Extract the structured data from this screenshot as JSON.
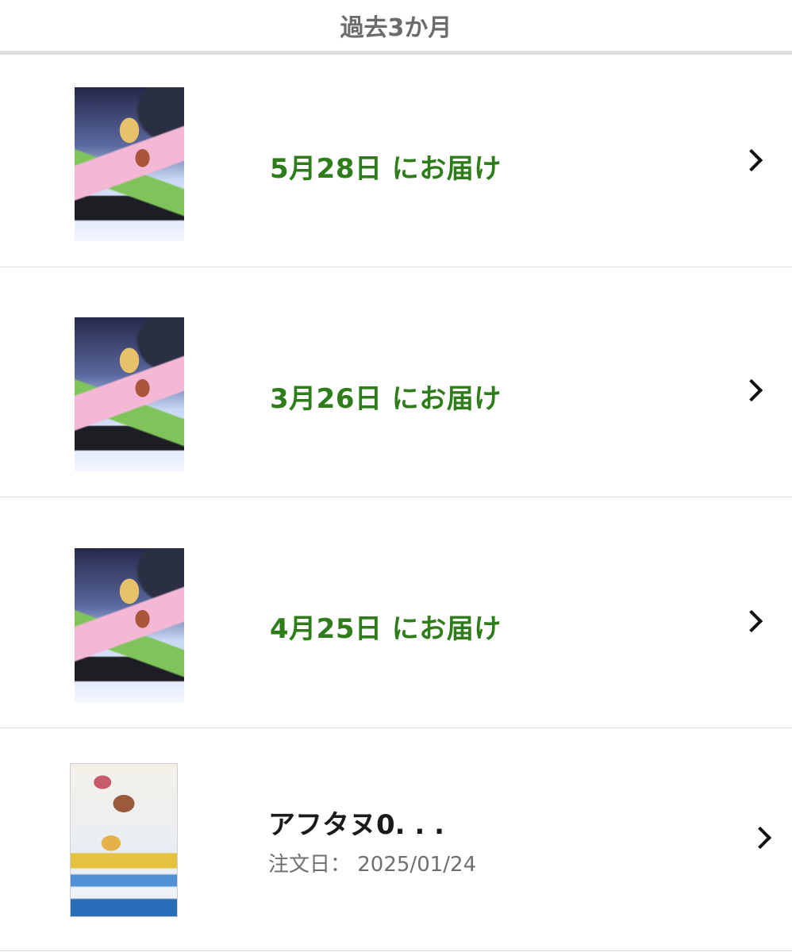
{
  "header": {
    "title": "過去3か月"
  },
  "orders": [
    {
      "delivery_label": "5月28日 にお届け"
    },
    {
      "delivery_label": "3月26日 にお届け"
    },
    {
      "delivery_label": "4月25日 にお届け"
    },
    {
      "title": "アフタヌ0. . .",
      "order_date": "注文日： 2025/01/24"
    }
  ],
  "icons": {
    "row_arrow": "chevron-right-icon"
  },
  "colors": {
    "delivery_text": "#2e7d1a",
    "title_text": "#1a1a1a",
    "meta_text": "#6f6f6f",
    "divider": "#dcdcdc"
  }
}
